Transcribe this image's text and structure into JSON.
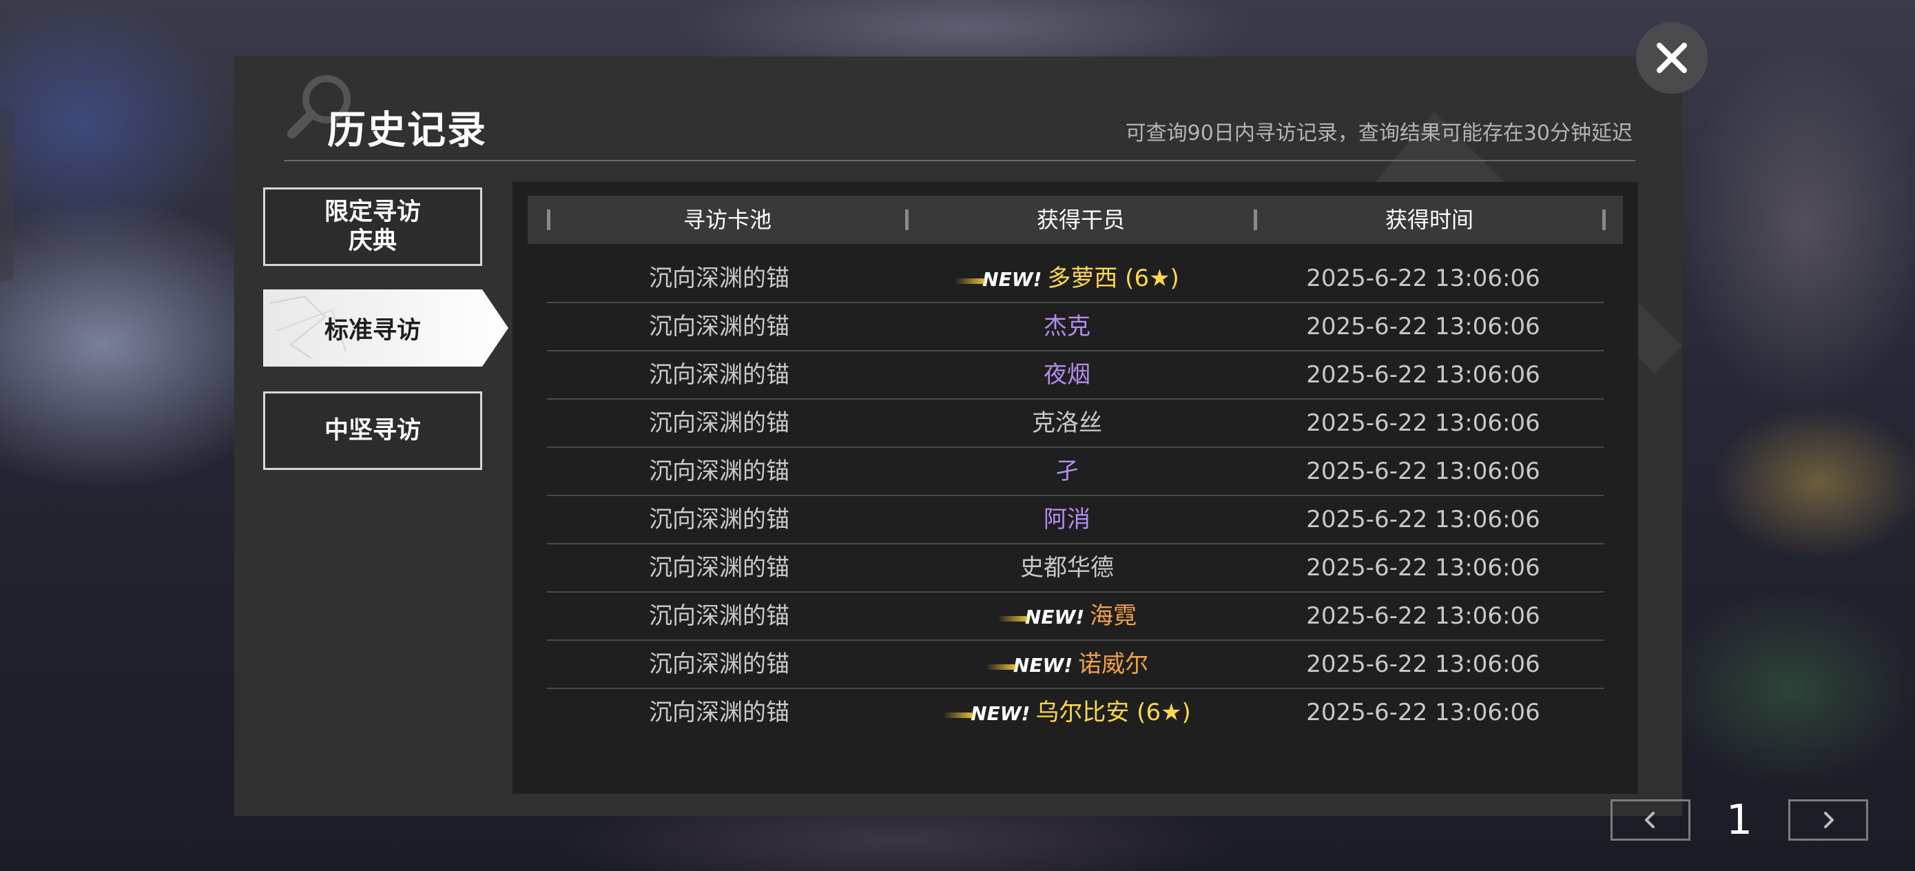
{
  "dialog": {
    "title": "历史记录",
    "subtitle": "可查询90日内寻访记录，查询结果可能存在30分钟延迟"
  },
  "nav": {
    "items": [
      {
        "label": "限定寻访\n庆典",
        "active": false
      },
      {
        "label": "标准寻访",
        "active": true
      },
      {
        "label": "中坚寻访",
        "active": false
      }
    ]
  },
  "table": {
    "headers": [
      "寻访卡池",
      "获得干员",
      "获得时间"
    ],
    "new_label": "NEW!",
    "rows": [
      {
        "pool": "沉向深渊的锚",
        "operator": "多萝西 (6★)",
        "time": "2025-6-22 13:06:06",
        "new": true,
        "color": "#ffd84a"
      },
      {
        "pool": "沉向深渊的锚",
        "operator": "杰克",
        "time": "2025-6-22 13:06:06",
        "new": false,
        "color": "#b48cf0"
      },
      {
        "pool": "沉向深渊的锚",
        "operator": "夜烟",
        "time": "2025-6-22 13:06:06",
        "new": false,
        "color": "#b48cf0"
      },
      {
        "pool": "沉向深渊的锚",
        "operator": "克洛丝",
        "time": "2025-6-22 13:06:06",
        "new": false,
        "color": "#c8c8c8"
      },
      {
        "pool": "沉向深渊的锚",
        "operator": "孑",
        "time": "2025-6-22 13:06:06",
        "new": false,
        "color": "#b48cf0"
      },
      {
        "pool": "沉向深渊的锚",
        "operator": "阿消",
        "time": "2025-6-22 13:06:06",
        "new": false,
        "color": "#b48cf0"
      },
      {
        "pool": "沉向深渊的锚",
        "operator": "史都华德",
        "time": "2025-6-22 13:06:06",
        "new": false,
        "color": "#c8c8c8"
      },
      {
        "pool": "沉向深渊的锚",
        "operator": "海霓",
        "time": "2025-6-22 13:06:06",
        "new": true,
        "color": "#f3a04a"
      },
      {
        "pool": "沉向深渊的锚",
        "operator": "诺威尔",
        "time": "2025-6-22 13:06:06",
        "new": true,
        "color": "#f3a04a"
      },
      {
        "pool": "沉向深渊的锚",
        "operator": "乌尔比安 (6★)",
        "time": "2025-6-22 13:06:06",
        "new": true,
        "color": "#ffd84a"
      }
    ]
  },
  "pagination": {
    "current": "1"
  },
  "icons": {
    "close": "close-icon",
    "prev": "chevron-left-icon",
    "next": "chevron-right-icon",
    "search": "search-icon"
  }
}
